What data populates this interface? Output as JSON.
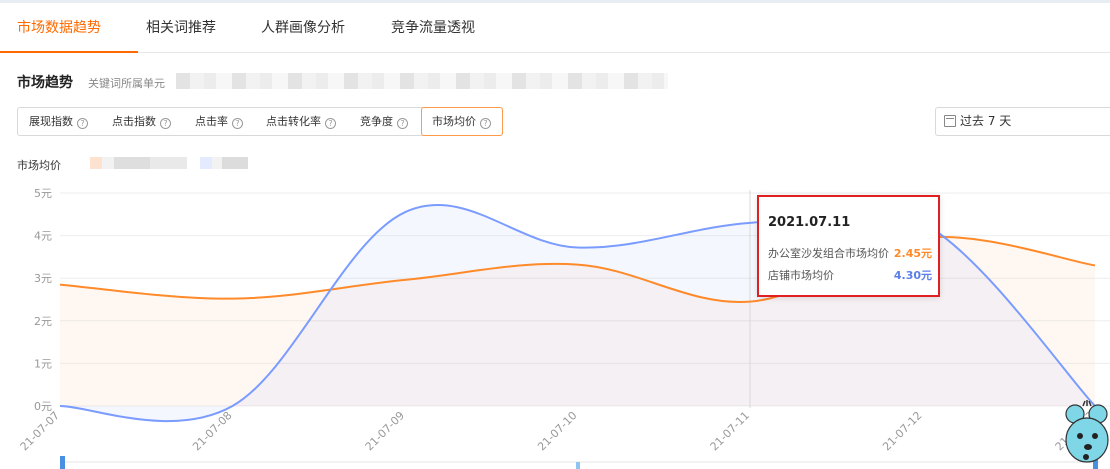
{
  "tabs": [
    {
      "label": "市场数据趋势",
      "active": true
    },
    {
      "label": "相关词推荐",
      "active": false
    },
    {
      "label": "人群画像分析",
      "active": false
    },
    {
      "label": "竞争流量透视",
      "active": false
    }
  ],
  "section": {
    "title": "市场趋势",
    "subtitle": "关键词所属单元"
  },
  "metrics": [
    {
      "label": "展现指数",
      "active": false
    },
    {
      "label": "点击指数",
      "active": false
    },
    {
      "label": "点击率",
      "active": false
    },
    {
      "label": "点击转化率",
      "active": false
    },
    {
      "label": "竞争度",
      "active": false
    },
    {
      "label": "市场均价",
      "active": true
    }
  ],
  "help_icon": "question-icon",
  "date_range": {
    "label": "过去 7 天",
    "icon": "calendar-icon"
  },
  "legend_label": "市场均价",
  "colors": {
    "accent": "#ff6a00",
    "series_orange": "#ff8a2a",
    "series_blue": "#7b9cff",
    "tooltip_border": "#e02020"
  },
  "chart_data": {
    "type": "line",
    "x": [
      "21-07-07",
      "21-07-08",
      "21-07-09",
      "21-07-10",
      "21-07-11",
      "21-07-12",
      "21-07-13"
    ],
    "series": [
      {
        "name": "办公室沙发组合市场均价",
        "values": [
          2.85,
          2.52,
          2.96,
          3.32,
          2.45,
          3.95,
          3.3
        ],
        "color": "#ff8a2a"
      },
      {
        "name": "店铺市场均价",
        "values": [
          0,
          0,
          4.55,
          3.72,
          4.3,
          4.3,
          0
        ],
        "color": "#7b9cff"
      }
    ],
    "y_ticks": [
      "0元",
      "1元",
      "2元",
      "3元",
      "4元",
      "5元"
    ],
    "ylim": [
      0,
      5
    ],
    "grid": true,
    "smooth": true,
    "highlight_index": 4
  },
  "tooltip": {
    "date": "2021.07.11",
    "rows": [
      {
        "label": "办公室沙发组合市场均价",
        "value": "2.45元",
        "color": "#ff8a2a"
      },
      {
        "label": "店铺市场均价",
        "value": "4.30元",
        "color": "#5b7fe8"
      }
    ]
  }
}
